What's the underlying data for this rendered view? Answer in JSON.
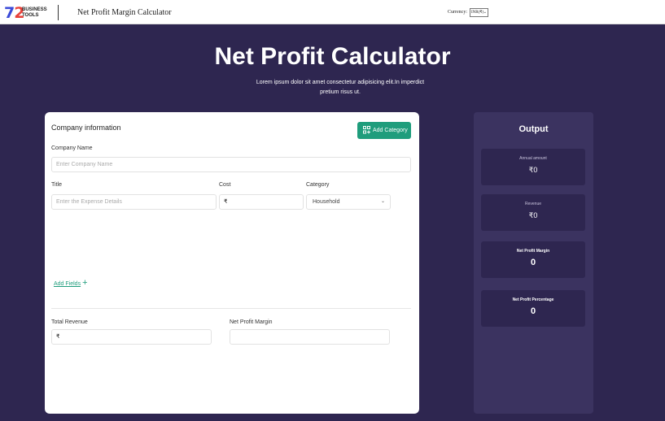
{
  "header": {
    "logo_number": "72",
    "logo_word_1": "BUSINESS",
    "logo_word_2": "TOOLS",
    "app_title": "Net Profit Margin Calculator",
    "currency_label": "Currency:",
    "currency_value": "INR(₹)"
  },
  "hero": {
    "title": "Net Profit Calculator",
    "subtitle": "Lorem ipsum dolor sit amet consectetur adipisicing elit.In imperdict pretium risus ut."
  },
  "form": {
    "heading": "Company information",
    "add_category_label": "Add Category",
    "company_name_label": "Company Name",
    "company_name_placeholder": "Enter Company Name",
    "title_label": "Title",
    "cost_label": "Cost",
    "category_label": "Category",
    "title_placeholder": "Enter the Expense Details",
    "cost_prefix": "₹",
    "category_value": "Household",
    "add_fields_label": "Add Fields",
    "total_revenue_label": "Total Revenue",
    "total_revenue_prefix": "₹",
    "net_profit_margin_label": "Net Profit Margin",
    "net_profit_margin_value": ""
  },
  "output": {
    "title": "Output",
    "items": [
      {
        "label": "Annual amount",
        "value": "₹0"
      },
      {
        "label": "Revenue",
        "value": "₹0"
      },
      {
        "label": "Net Profit Margin",
        "value": "0"
      },
      {
        "label": "Net Profit Percentage",
        "value": "0"
      }
    ]
  },
  "colors": {
    "background": "#2e2650",
    "accent": "#1f9d7c",
    "output_panel": "#3b3360"
  }
}
